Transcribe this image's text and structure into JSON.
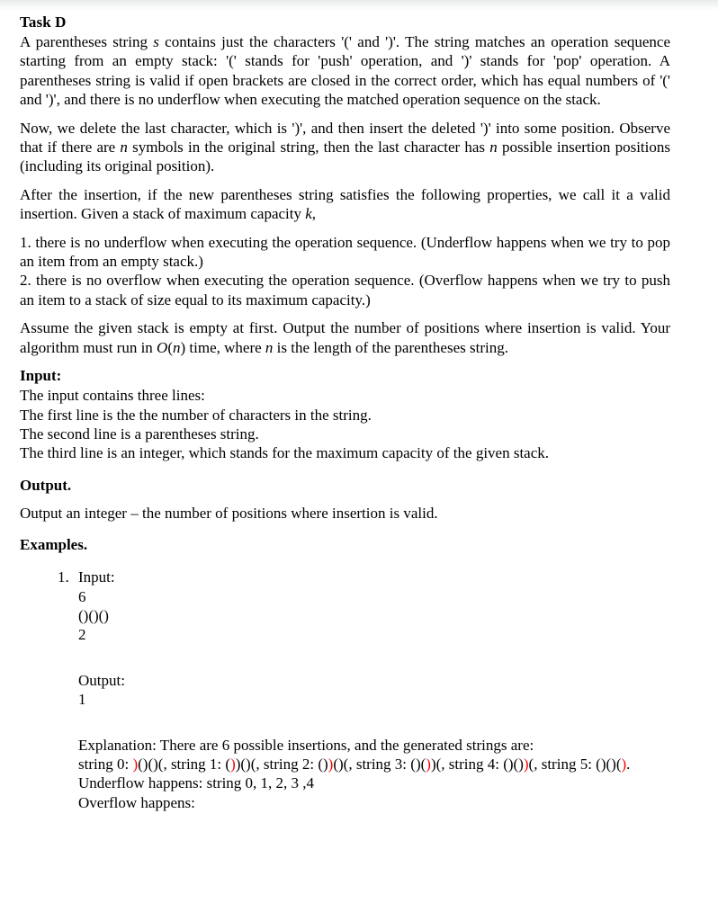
{
  "document": {
    "title": "Task D",
    "paragraphs": {
      "p1": "A parentheses string s contains just the characters '(' and ')'. The string matches an operation sequence starting from an empty stack: '(' stands for 'push' operation, and ')' stands for 'pop' operation. A parentheses string is valid if open brackets are closed in the correct order, which has equal numbers of '(' and ')', and there is no underflow when executing the matched operation sequence on the stack.",
      "p2": "Now, we delete the last character, which is ')', and then insert the deleted ')' into some position. Observe that if there are n symbols in the original string, then the last character has n possible insertion positions (including its original position).",
      "p3": "After the insertion, if the new parentheses string satisfies the following properties, we call it a valid insertion. Given a stack of maximum capacity k,",
      "p4": "Assume the given stack is empty at first. Output the number of positions where insertion is valid. Your algorithm must run in O(n) time, where n is the length of the parentheses string."
    },
    "properties": [
      "1. there is no underflow when executing the operation sequence. (Underflow happens when we try to pop an item from an empty stack.)",
      "2. there is no overflow when executing the operation sequence. (Overflow happens when we try to push an item to a stack of size equal to its maximum capacity.)"
    ],
    "input_section": {
      "heading": "Input:",
      "lines": [
        "The input contains three lines:",
        "The first line is the the number of characters in the string.",
        "The second line is a parentheses string.",
        "The third line is an integer, which stands for the maximum capacity of the given stack."
      ]
    },
    "output_section": {
      "heading": "Output.",
      "text": "Output an integer – the number of positions where insertion is valid."
    },
    "examples_section": {
      "heading": "Examples.",
      "items": [
        {
          "marker": "1.",
          "input_label": "Input:",
          "input_lines": [
            "6",
            "()()()",
            "2"
          ],
          "output_label": "Output:",
          "output_lines": [
            "1"
          ],
          "explanation": {
            "intro": "Explanation: There are 6 possible insertions, and the generated strings are:",
            "strings": [
              {
                "label": "string 0:",
                "before": "",
                "inserted": ")",
                "after": "()()("
              },
              {
                "label": "string 1:",
                "before": "(",
                "inserted": ")",
                "after": ")()("
              },
              {
                "label": "string 2:",
                "before": "()",
                "inserted": ")",
                "after": "()("
              },
              {
                "label": "string 3:",
                "before": "()(",
                "inserted": ")",
                "after": ")("
              },
              {
                "label": "string 4:",
                "before": "()()",
                "inserted": ")",
                "after": "("
              },
              {
                "label": "string 5:",
                "before": "()()(",
                "inserted": ")",
                "after": ""
              }
            ],
            "underflow": "Underflow happens: string 0, 1, 2, 3 ,4",
            "overflow": "Overflow happens:"
          }
        }
      ]
    },
    "colors": {
      "text": "#000000",
      "highlight": "#ff0000",
      "page_background": "#ffffff"
    }
  }
}
